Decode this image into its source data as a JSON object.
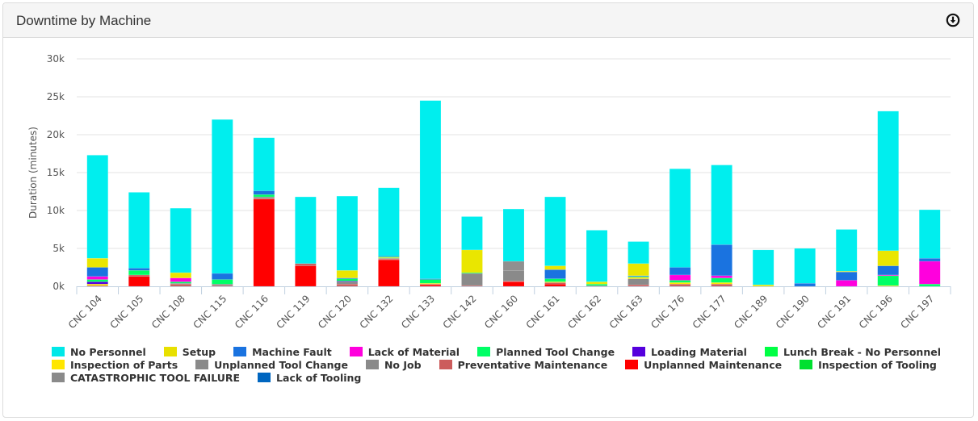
{
  "panel": {
    "title": "Downtime by Machine",
    "download_icon": "download-circle-icon"
  },
  "chart_data": {
    "type": "bar",
    "stacked": true,
    "title": "Downtime by Machine",
    "xlabel": "",
    "ylabel": "Duration (minutes)",
    "ylim": [
      0,
      30000
    ],
    "yticks": [
      0,
      5000,
      10000,
      15000,
      20000,
      25000,
      30000
    ],
    "ytick_labels": [
      "0k",
      "5k",
      "10k",
      "15k",
      "20k",
      "25k",
      "30k"
    ],
    "grid": true,
    "legend_position": "bottom",
    "categories": [
      "CNC 104",
      "CNC 105",
      "CNC 108",
      "CNC 115",
      "CNC 116",
      "CNC 119",
      "CNC 120",
      "CNC 132",
      "CNC 133",
      "CNC 142",
      "CNC 160",
      "CNC 161",
      "CNC 162",
      "CNC 163",
      "CNC 176",
      "CNC 177",
      "CNC 189",
      "CNC 190",
      "CNC 191",
      "CNC 196",
      "CNC 197"
    ],
    "series": [
      {
        "name": "Inspection of Tooling",
        "color": "#00e030",
        "values": [
          0,
          0,
          0,
          0,
          0,
          0,
          0,
          0,
          0,
          0,
          0,
          0,
          0,
          0,
          0,
          0,
          0,
          0,
          0,
          0,
          0
        ]
      },
      {
        "name": "Lack of Tooling",
        "color": "#0066c0",
        "values": [
          0,
          0,
          0,
          0,
          0,
          0,
          0,
          0,
          0,
          0,
          0,
          0,
          0,
          0,
          0,
          0,
          0,
          0,
          0,
          0,
          0
        ]
      },
      {
        "name": "Unplanned Maintenance",
        "color": "#ff0000",
        "values": [
          0,
          1300,
          0,
          0,
          11500,
          2700,
          0,
          3500,
          200,
          0,
          600,
          300,
          0,
          0,
          0,
          0,
          0,
          0,
          0,
          0,
          0
        ]
      },
      {
        "name": "Preventative Maintenance",
        "color": "#cc5c5c",
        "values": [
          100,
          200,
          300,
          100,
          100,
          300,
          300,
          100,
          100,
          100,
          100,
          200,
          0,
          200,
          300,
          300,
          0,
          0,
          0,
          0,
          0
        ]
      },
      {
        "name": "CATASTROPHIC TOOL FAILURE",
        "color": "#8a8a8a",
        "values": [
          0,
          0,
          0,
          0,
          0,
          0,
          0,
          0,
          0,
          0,
          0,
          0,
          0,
          0,
          0,
          0,
          0,
          0,
          0,
          0,
          0
        ]
      },
      {
        "name": "No Job",
        "color": "#8a8a8a",
        "values": [
          0,
          0,
          100,
          200,
          200,
          0,
          300,
          100,
          0,
          1600,
          1400,
          0,
          100,
          800,
          0,
          0,
          0,
          0,
          0,
          0,
          0
        ]
      },
      {
        "name": "Unplanned Tool Change",
        "color": "#909090",
        "values": [
          0,
          0,
          0,
          0,
          0,
          0,
          0,
          0,
          0,
          0,
          1200,
          0,
          0,
          0,
          0,
          0,
          0,
          0,
          0,
          0,
          0
        ]
      },
      {
        "name": "Inspection of Parts",
        "color": "#ffe600",
        "values": [
          200,
          0,
          0,
          0,
          0,
          0,
          0,
          100,
          100,
          0,
          0,
          100,
          0,
          200,
          200,
          200,
          0,
          0,
          0,
          100,
          0
        ]
      },
      {
        "name": "Loading Material",
        "color": "#5500dd",
        "values": [
          300,
          0,
          0,
          0,
          0,
          0,
          100,
          0,
          0,
          0,
          0,
          0,
          0,
          0,
          0,
          0,
          0,
          0,
          0,
          0,
          0
        ]
      },
      {
        "name": "Lunch Break - No Personnel",
        "color": "#00ff44",
        "values": [
          0,
          0,
          0,
          0,
          0,
          0,
          0,
          0,
          0,
          0,
          0,
          0,
          0,
          0,
          0,
          0,
          0,
          0,
          0,
          0,
          0
        ]
      },
      {
        "name": "Planned Tool Change",
        "color": "#00ff66",
        "values": [
          300,
          600,
          200,
          600,
          300,
          0,
          300,
          100,
          500,
          100,
          0,
          400,
          200,
          100,
          300,
          600,
          0,
          0,
          0,
          1300,
          300
        ]
      },
      {
        "name": "Lack of Material",
        "color": "#ff00dd",
        "values": [
          400,
          0,
          500,
          0,
          0,
          0,
          0,
          0,
          0,
          0,
          0,
          0,
          0,
          0,
          700,
          300,
          0,
          0,
          800,
          100,
          3000
        ]
      },
      {
        "name": "Machine Fault",
        "color": "#1a73e0",
        "values": [
          1200,
          300,
          0,
          800,
          500,
          0,
          100,
          100,
          100,
          0,
          0,
          1200,
          0,
          100,
          1000,
          4100,
          0,
          400,
          1100,
          1200,
          400
        ]
      },
      {
        "name": "Setup",
        "color": "#eae600",
        "values": [
          1200,
          0,
          700,
          0,
          0,
          0,
          1000,
          0,
          0,
          3000,
          0,
          500,
          300,
          1600,
          0,
          0,
          200,
          0,
          100,
          2000,
          0
        ]
      },
      {
        "name": "No Personnel",
        "color": "#00eeee",
        "values": [
          13600,
          10000,
          8500,
          20300,
          7000,
          8800,
          9800,
          9000,
          23500,
          4400,
          6900,
          9100,
          6800,
          2900,
          13000,
          10500,
          4600,
          4600,
          5500,
          18400,
          6400
        ]
      }
    ],
    "legend_order": [
      [
        "No Personnel",
        "Setup",
        "Machine Fault",
        "Lack of Material",
        "Planned Tool Change",
        "Loading Material",
        "Lunch Break - No Personnel"
      ],
      [
        "Inspection of Parts",
        "Unplanned Tool Change",
        "No Job",
        "Preventative Maintenance",
        "Unplanned Maintenance",
        "Inspection of Tooling"
      ],
      [
        "CATASTROPHIC TOOL FAILURE",
        "Lack of Tooling"
      ]
    ],
    "legend_colors": {
      "No Personnel": "#00e8e8",
      "Setup": "#e8e000",
      "Machine Fault": "#1a73e0",
      "Lack of Material": "#ff00dd",
      "Planned Tool Change": "#00ff66",
      "Loading Material": "#5500dd",
      "Lunch Break - No Personnel": "#00ff44",
      "Inspection of Parts": "#ffe600",
      "Unplanned Tool Change": "#8a8a8a",
      "No Job": "#8a8a8a",
      "Preventative Maintenance": "#cc5c5c",
      "Unplanned Maintenance": "#ff0000",
      "Inspection of Tooling": "#00e030",
      "CATASTROPHIC TOOL FAILURE": "#8a8a8a",
      "Lack of Tooling": "#0066c0"
    }
  }
}
